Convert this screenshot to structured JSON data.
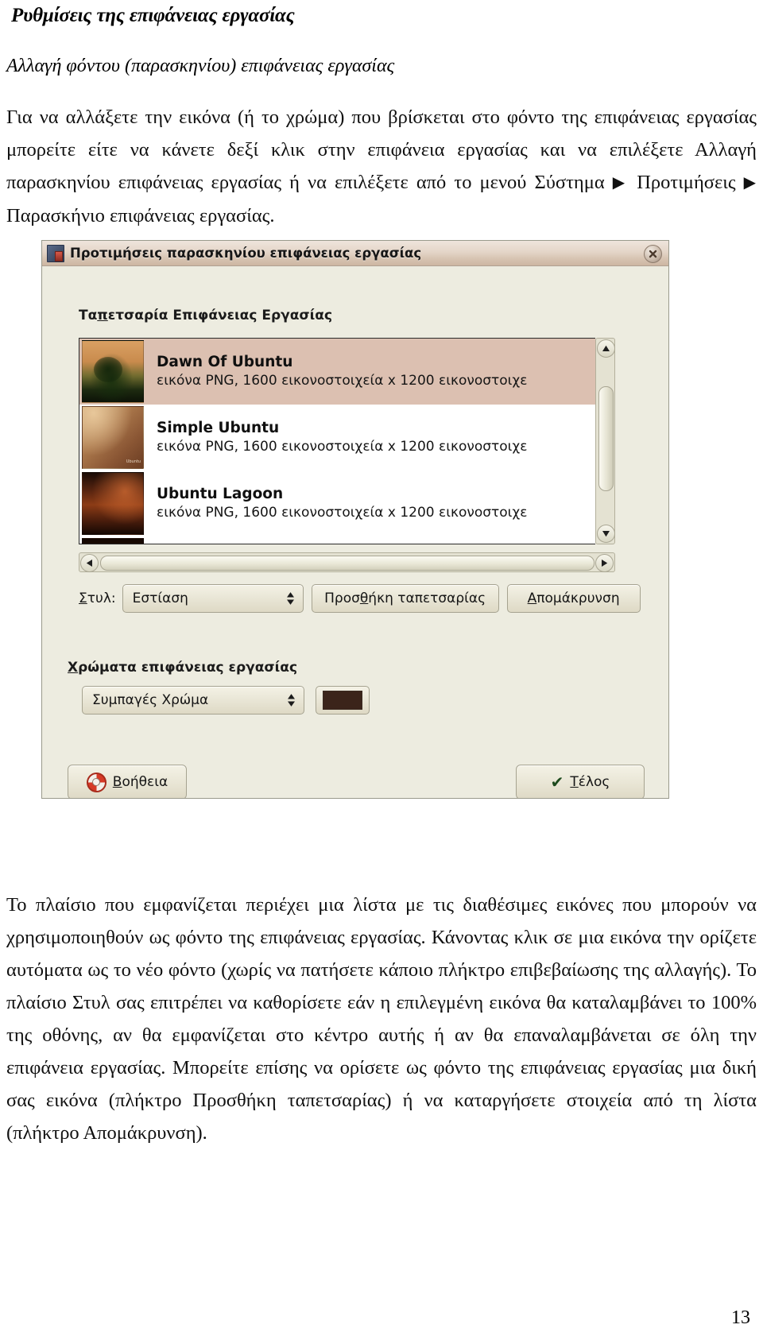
{
  "document": {
    "heading": "Ρυθμίσεις της επιφάνειας εργασίας",
    "subheading": "Αλλαγή φόντου (παρασκηνίου) επιφάνειας εργασίας",
    "paragraph_top_1": "Για να αλλάξετε την εικόνα (ή το χρώμα) που βρίσκεται στο φόντο της επιφάνειας εργασίας μπορείτε είτε να κάνετε δεξί κλικ στην επιφάνεια εργασίας και να επιλέξετε Αλλαγή παρασκηνίου επιφάνειας εργασίας ή να επιλέξετε από το μενού Σύστημα ",
    "paragraph_top_2": " Προτιμήσεις ",
    "paragraph_top_3": " Παρασκήνιο επιφάνειας εργασίας.",
    "menu_arrow": "▶",
    "paragraph_bottom": "Το πλαίσιο που εμφανίζεται περιέχει μια λίστα με τις διαθέσιμες εικόνες που μπορούν να χρησιμοποιηθούν ως φόντο της επιφάνειας εργασίας. Κάνοντας κλικ σε μια εικόνα την ορίζετε αυτόματα ως το νέο φόντο (χωρίς να πατήσετε κάποιο πλήκτρο επιβεβαίωσης της αλλαγής). Το πλαίσιο Στυλ σας επιτρέπει να καθορίσετε εάν η επιλεγμένη εικόνα θα καταλαμβάνει το 100% της οθόνης, αν θα εμφανίζεται στο κέντρο αυτής ή αν θα επαναλαμβάνεται σε όλη την επιφάνεια εργασίας. Μπορείτε επίσης να ορίσετε ως φόντο της επιφάνειας εργασίας μια δική σας εικόνα (πλήκτρο Προσθήκη ταπετσαρίας) ή να καταργήσετε στοιχεία από τη λίστα (πλήκτρο Απομάκρυνση).",
    "page_number": "13"
  },
  "dialog": {
    "title": "Προτιμήσεις παρασκηνίου επιφάνειας εργασίας",
    "title_icon": "desktop-preferences-icon",
    "close_icon": "close-icon",
    "wallpaper_section": {
      "label_accel": "π",
      "label_before": "Τα",
      "label_after": "ετσαρία Επιφάνειας Εργασίας",
      "full_label": "Ταπετσαρία Επιφάνειας Εργασίας"
    },
    "wallpapers": [
      {
        "name": "Dawn Of Ubuntu",
        "details": "εικόνα PNG, 1600 εικονοστοιχεία x 1200 εικονοστοιχε",
        "selected": true,
        "thumb": "dawn-of-ubuntu-thumbnail"
      },
      {
        "name": "Simple Ubuntu",
        "details": "εικόνα PNG, 1600 εικονοστοιχεία x 1200 εικονοστοιχε",
        "selected": false,
        "thumb": "simple-ubuntu-thumbnail"
      },
      {
        "name": "Ubuntu Lagoon",
        "details": "εικόνα PNG, 1600 εικονοστοιχεία x 1200 εικονοστοιχε",
        "selected": false,
        "thumb": "ubuntu-lagoon-thumbnail"
      },
      {
        "name": "",
        "details": "",
        "selected": false,
        "thumb": "partial-wallpaper-thumbnail"
      }
    ],
    "style_row": {
      "label_accel": "Σ",
      "label_rest": "τυλ:",
      "label_full": "Στυλ:",
      "style_value": "Εστίαση",
      "add_button_before": "Προσ",
      "add_button_accel": "θ",
      "add_button_after": "ήκη ταπετσαρίας",
      "add_button_full": "Προσθήκη ταπετσαρίας",
      "remove_button_accel": "Α",
      "remove_button_rest": "πομάκρυνση",
      "remove_button_full": "Απομάκρυνση"
    },
    "colors_section": {
      "label_accel": "Χ",
      "label_rest": "ρώματα επιφάνειας εργασίας",
      "label_full": "Χρώματα επιφάνειας εργασίας",
      "color_mode": "Συμπαγές Χρώμα",
      "color_value": "#3b241a"
    },
    "footer": {
      "help_accel": "Β",
      "help_rest": "οήθεια",
      "help_full": "Βοήθεια",
      "help_icon": "life-ring-help-icon",
      "close_accel": "Τ",
      "close_rest": "έλος",
      "close_full": "Τέλος",
      "close_icon": "check-mark-icon"
    },
    "scrollbars": {
      "vertical_up_icon": "scroll-up-arrow-icon",
      "vertical_down_icon": "scroll-down-arrow-icon",
      "horizontal_left_icon": "scroll-left-arrow-icon",
      "horizontal_right_icon": "scroll-right-arrow-icon"
    },
    "colors": {
      "window_bg": "#edece0",
      "titlebar": "#dcc8b6",
      "selection": "#dcc0b1"
    }
  }
}
